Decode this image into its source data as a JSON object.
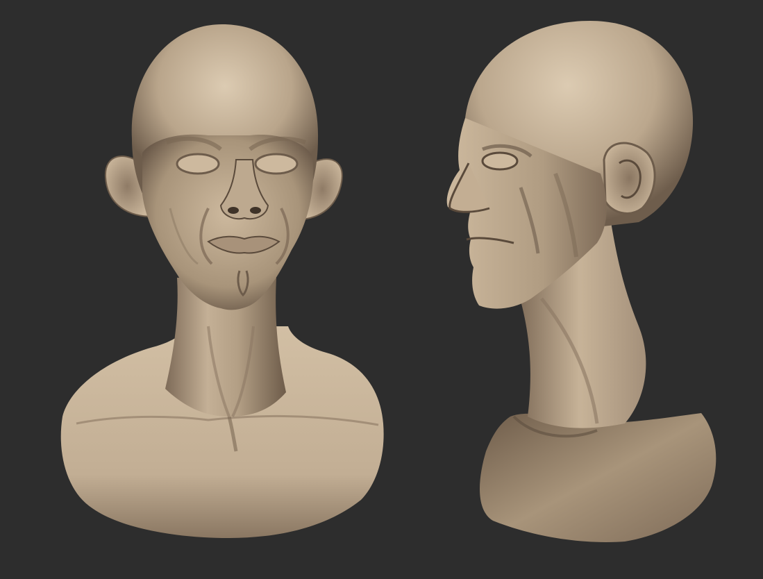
{
  "scene": {
    "subject": "sculpted-head-bust",
    "views": [
      {
        "id": "front",
        "label": ""
      },
      {
        "id": "three-quarter-profile",
        "label": ""
      }
    ],
    "colors": {
      "background": "#2d2d2d",
      "clay_light": "#d8c6ac",
      "clay_mid": "#b29e84",
      "clay_shadow": "#6d5c4b",
      "clay_deep": "#3f3328"
    }
  }
}
